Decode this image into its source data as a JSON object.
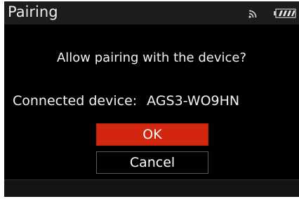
{
  "header": {
    "title": "Pairing"
  },
  "dialog": {
    "prompt": "Allow pairing with the device?",
    "device_label": "Connected device:",
    "device_name": "AGS3-WO9HN",
    "ok_label": "OK",
    "cancel_label": "Cancel"
  },
  "status": {
    "wifi_icon": "wifi-signal-icon",
    "battery_icon": "battery-full-icon"
  },
  "colors": {
    "accent_ok": "#d2260f",
    "background": "#000000",
    "text": "#f2f2f2"
  }
}
